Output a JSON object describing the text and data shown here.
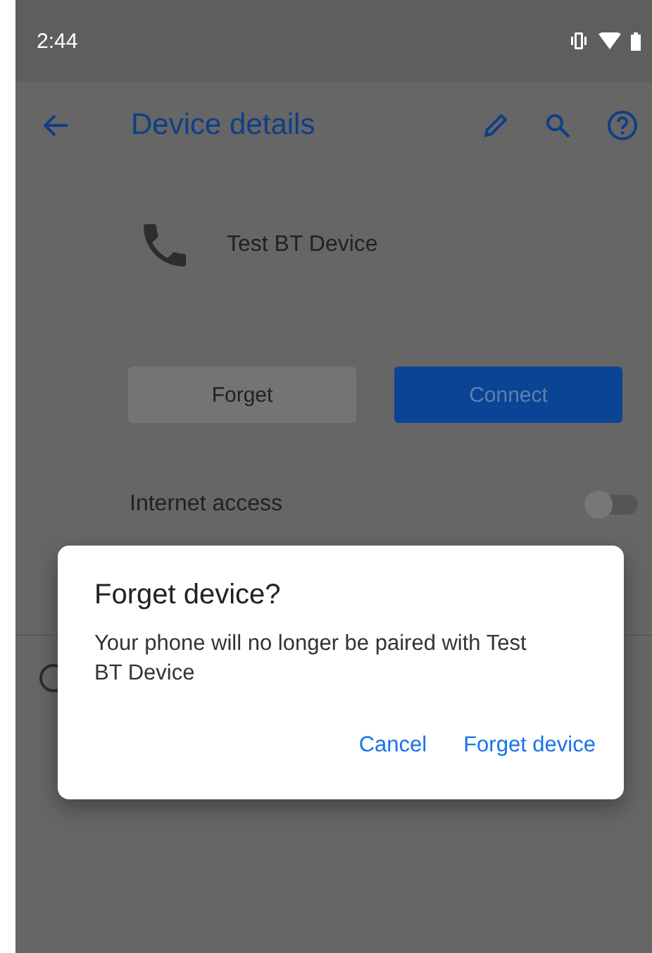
{
  "status_bar": {
    "time": "2:44"
  },
  "toolbar": {
    "title": "Device details"
  },
  "device": {
    "name": "Test BT Device"
  },
  "buttons": [
    {
      "label": "Forget",
      "kind": "secondary"
    },
    {
      "label": "Connect",
      "kind": "primary"
    }
  ],
  "settings": [
    {
      "label": "Internet access",
      "on": false
    }
  ],
  "dialog": {
    "title": "Forget device?",
    "message": "Your phone will no longer be paired with Test BT Device",
    "actions": [
      "Cancel",
      "Forget device"
    ]
  }
}
